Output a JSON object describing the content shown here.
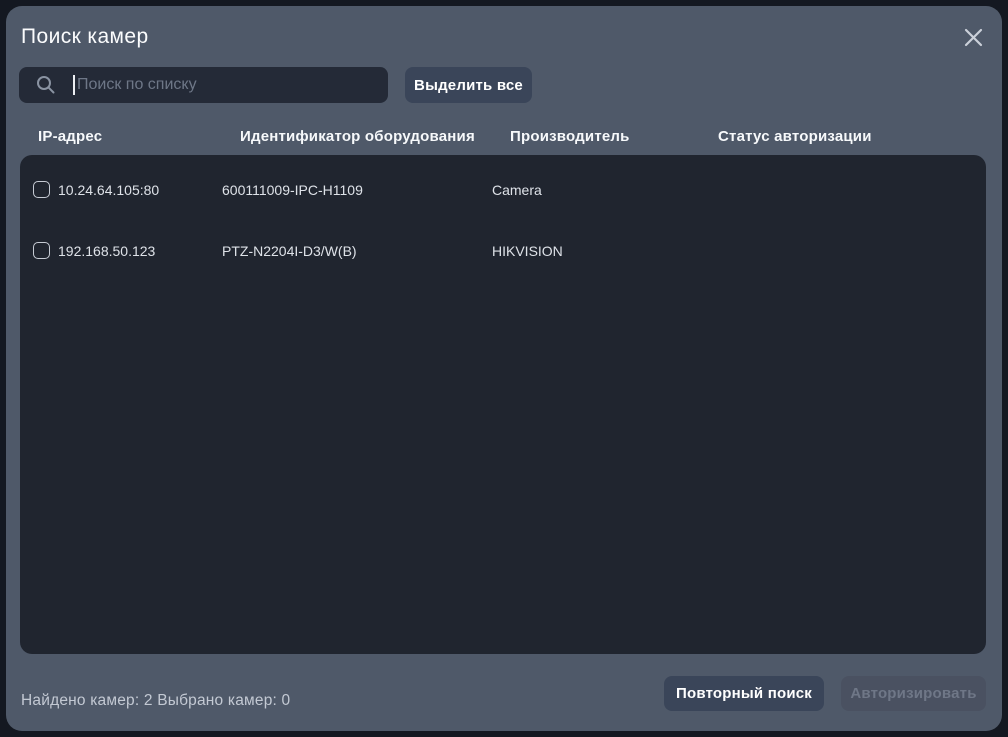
{
  "dialog": {
    "title": "Поиск камер"
  },
  "toolbar": {
    "search_placeholder": "Поиск по списку",
    "search_value": "",
    "select_all_label": "Выделить все"
  },
  "table": {
    "columns": [
      "IP-адрес",
      "Идентификатор оборудования",
      "Производитель",
      "Статус авторизации"
    ],
    "rows": [
      {
        "checked": false,
        "ip": "10.24.64.105:80",
        "device_id": "600111009-IPC-H1109",
        "manufacturer": "Camera",
        "auth_status": ""
      },
      {
        "checked": false,
        "ip": "192.168.50.123",
        "device_id": "PTZ-N2204I-D3/W(B)",
        "manufacturer": "HIKVISION",
        "auth_status": ""
      }
    ]
  },
  "footer": {
    "found_cameras": 2,
    "selected_cameras": 0,
    "summary": "Найдено камер: 2 Выбрано камер: 0",
    "repeat_search_label": "Повторный поиск",
    "authorize_label": "Авторизировать"
  },
  "colors": {
    "backdrop": "#141821",
    "dialog_bg": "#4F5969",
    "panel_bg": "#20252F",
    "input_bg": "#242A37",
    "button_bg": "#3A4559",
    "button_disabled_bg": "#4A5161",
    "button_disabled_text": "#6F7787",
    "text_primary": "#F5F7FA",
    "text_row": "#DEE2E8",
    "text_muted": "#C3C9D3",
    "placeholder": "#6E7787"
  }
}
